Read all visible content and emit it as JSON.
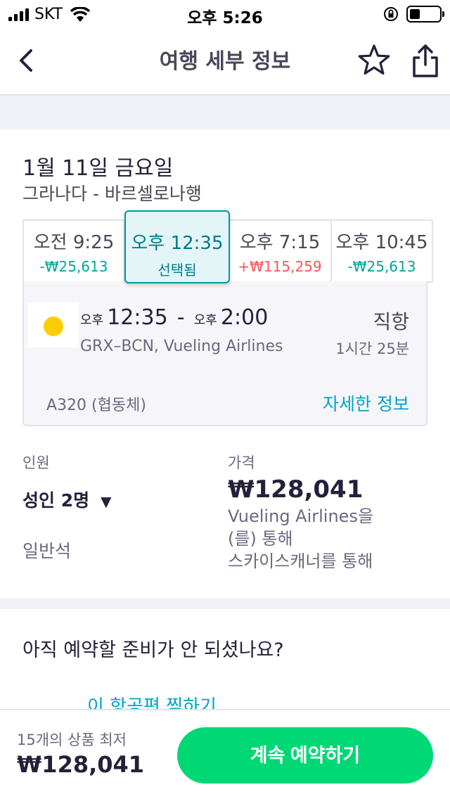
{
  "status_bar": {
    "carrier": "SKT",
    "time": "오후 5:26"
  },
  "nav": {
    "title": "여행 세부 정보",
    "back_icon": "chevron-left-icon",
    "favorite_icon": "star-icon",
    "share_icon": "share-icon"
  },
  "trip": {
    "date": "1월 11일 금요일",
    "route": "그라나다 - 바르셀로나행"
  },
  "time_options": [
    {
      "time": "오전 9:25",
      "diff": "-₩25,613"
    },
    {
      "time": "오후 12:35",
      "diff": "선택됨",
      "selected": true
    },
    {
      "time": "오후 7:15",
      "diff": "+₩115,259"
    },
    {
      "time": "오후 10:45",
      "diff": "-₩25,613"
    }
  ],
  "flight": {
    "depart_ampm": "오후",
    "depart_time": "12:35",
    "arrive_ampm": "오후",
    "arrive_time": "2:00",
    "sub": "GRX–BCN, Vueling Airlines",
    "stops": "직항",
    "duration": "1시간 25분",
    "aircraft": "A320 (협동체)",
    "details_link": "자세한 정보",
    "logo_color": "#ffcc00"
  },
  "passengers": {
    "label": "인원",
    "value": "성인 2명",
    "cabin": "일반석"
  },
  "price": {
    "label": "가격",
    "value": "₩128,041",
    "note": "Vueling Airlines을(를) 통해\n스카이스캐너를 통해"
  },
  "not_ready": {
    "title": "아직 예약할 준비가 안 되셨나요?",
    "save_link": "이 항공편 찜하기"
  },
  "bottom": {
    "cheapest_label": "15개의 상품 최저",
    "cheapest_price": "₩128,041",
    "continue_label": "계속 예약하기"
  },
  "colors": {
    "accent": "#00a3c9",
    "selected": "#0096a5",
    "cta": "#00d775",
    "positive": "#00a698",
    "negative": "#ff5452"
  }
}
